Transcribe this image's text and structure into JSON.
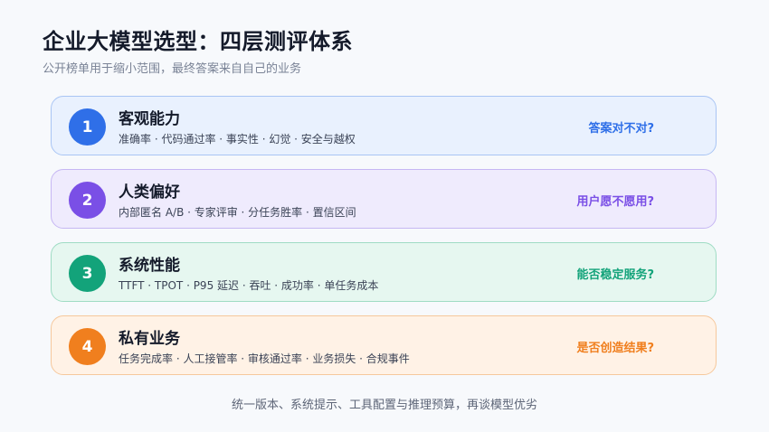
{
  "title": "企业大模型选型：四层测评体系",
  "subtitle": "公开榜单用于缩小范围，最终答案来自自己的业务",
  "layers": [
    {
      "number": "1",
      "name": "客观能力",
      "metrics": "准确率 · 代码通过率 · 事实性 · 幻觉 · 安全与越权",
      "question": "答案对不对?",
      "accent": "#2f6fe8",
      "bg": "#e9f1fe",
      "border": "#a9c5f4"
    },
    {
      "number": "2",
      "name": "人类偏好",
      "metrics": "内部匿名 A/B · 专家评审 · 分任务胜率 · 置信区间",
      "question": "用户愿不愿用?",
      "accent": "#7a4fe6",
      "bg": "#efebfd",
      "border": "#c6b7f3"
    },
    {
      "number": "3",
      "name": "系统性能",
      "metrics": "TTFT · TPOT · P95 延迟 · 吞吐 · 成功率 · 单任务成本",
      "question": "能否稳定服务?",
      "accent": "#13a37a",
      "bg": "#e6f7f0",
      "border": "#9fdcc4"
    },
    {
      "number": "4",
      "name": "私有业务",
      "metrics": "任务完成率 · 人工接管率 · 审核通过率 · 业务损失 · 合规事件",
      "question": "是否创造结果?",
      "accent": "#f07f1e",
      "bg": "#fff2e6",
      "border": "#f6c89c"
    }
  ],
  "footer": "统一版本、系统提示、工具配置与推理预算，再谈模型优劣"
}
